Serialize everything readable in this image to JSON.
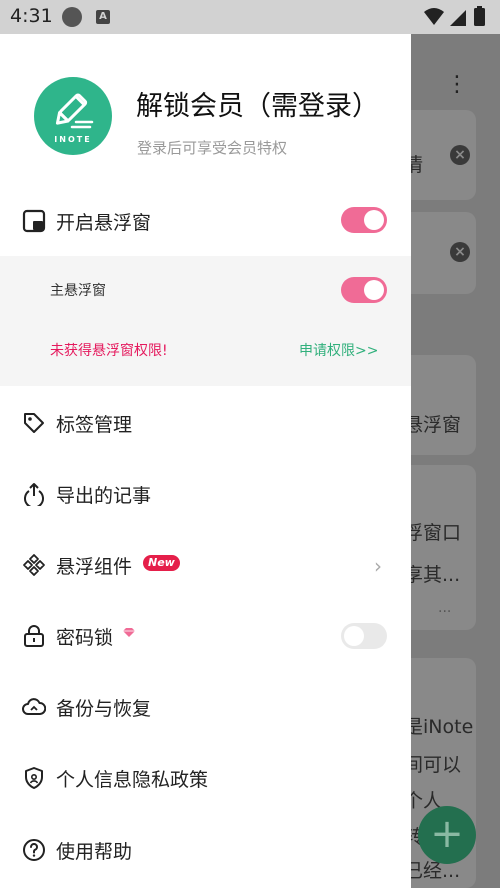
{
  "status_bar": {
    "time": "4:31",
    "app_icon_letter": "A"
  },
  "background": {
    "menu_glyph": "⋮",
    "close_glyph": "×",
    "fab_glyph": "+",
    "snippets": [
      "情",
      "-",
      "悬浮窗",
      "浮窗口",
      "享其...",
      "...",
      "是iNote",
      "间可以",
      "个人",
      "转",
      "已经..."
    ]
  },
  "drawer": {
    "logo": {
      "label": "INOTE",
      "color": "#2fb58b"
    },
    "vip_title": "解锁会员（需登录）",
    "vip_subtitle": "登录后可享受会员特权",
    "float_window": {
      "label": "开启悬浮窗",
      "enabled": true,
      "main_float": {
        "label": "主悬浮窗",
        "enabled": true
      },
      "permission_warning": "未获得悬浮窗权限!",
      "apply_link": "申请权限>>"
    },
    "menu": {
      "tags": "标签管理",
      "export": "导出的记事",
      "widgets": "悬浮组件",
      "widgets_badge": "New",
      "widgets_chevron": "›",
      "password": "密码锁",
      "password_enabled": false,
      "backup": "备份与恢复",
      "privacy": "个人信息隐私政策",
      "help": "使用帮助"
    }
  },
  "colors": {
    "accent_pink": "#f06b96",
    "warning_red": "#e5195d",
    "link_green": "#31b07c",
    "fab_green": "#236f4f"
  },
  "icons": [
    "wifi-icon",
    "signal-icon",
    "battery-icon",
    "float-window-icon",
    "tag-icon",
    "export-icon",
    "widget-icon",
    "lock-icon",
    "gem-icon",
    "cloud-icon",
    "shield-icon",
    "help-icon",
    "more-icon",
    "close-icon",
    "add-icon"
  ]
}
